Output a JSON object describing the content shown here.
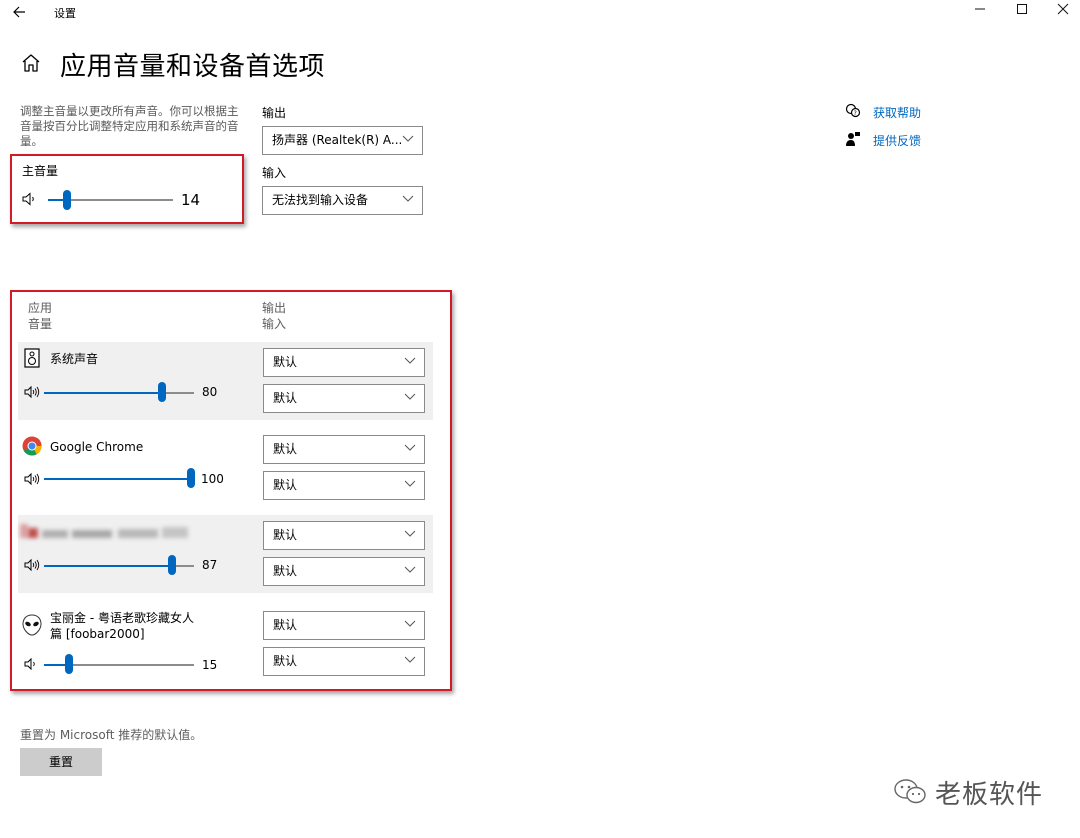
{
  "titlebar": {
    "back_icon": "arrow-left-icon",
    "title": "设置",
    "minimize_label": "–",
    "maximize_label": "☐",
    "close_label": "✕"
  },
  "header": {
    "home_icon": "home-icon",
    "title": "应用音量和设备首选项"
  },
  "intro": {
    "description": "调整主音量以更改所有声音。你可以根据主音量按百分比调整特定应用和系统声音的音量。"
  },
  "master": {
    "label": "主音量",
    "value": "14",
    "level": 14
  },
  "device": {
    "output_label": "输出",
    "output_value": "扬声器 (Realtek(R) A...",
    "input_label": "输入",
    "input_value": "无法找到输入设备"
  },
  "apps_header": {
    "col1_line1": "应用",
    "col1_line2": "音量",
    "col2_line1": "输出",
    "col2_line2": "输入"
  },
  "apps": [
    {
      "name": "系统声音",
      "icon": "speaker-icon",
      "value": "80",
      "level": 80,
      "output": "默认",
      "input": "默认"
    },
    {
      "name": "Google Chrome",
      "icon": "chrome-icon",
      "value": "100",
      "level": 100,
      "output": "默认",
      "input": "默认"
    },
    {
      "name": "",
      "icon": "blurred-app-icon",
      "value": "87",
      "level": 87,
      "output": "默认",
      "input": "默认"
    },
    {
      "name_line1": "宝丽金 - 粤语老歌珍藏女人",
      "name_line2": "篇  [foobar2000]",
      "icon": "foobar-alien-icon",
      "value": "15",
      "level": 15,
      "output": "默认",
      "input": "默认"
    }
  ],
  "help": {
    "get_help": "获取帮助",
    "feedback": "提供反馈"
  },
  "reset": {
    "text": "重置为 Microsoft 推荐的默认值。",
    "button": "重置"
  },
  "watermark": {
    "text": "老板软件"
  },
  "colors": {
    "accent": "#0067c0",
    "annotation_red": "#d11c26",
    "row_highlight": "#f0f0f0"
  }
}
